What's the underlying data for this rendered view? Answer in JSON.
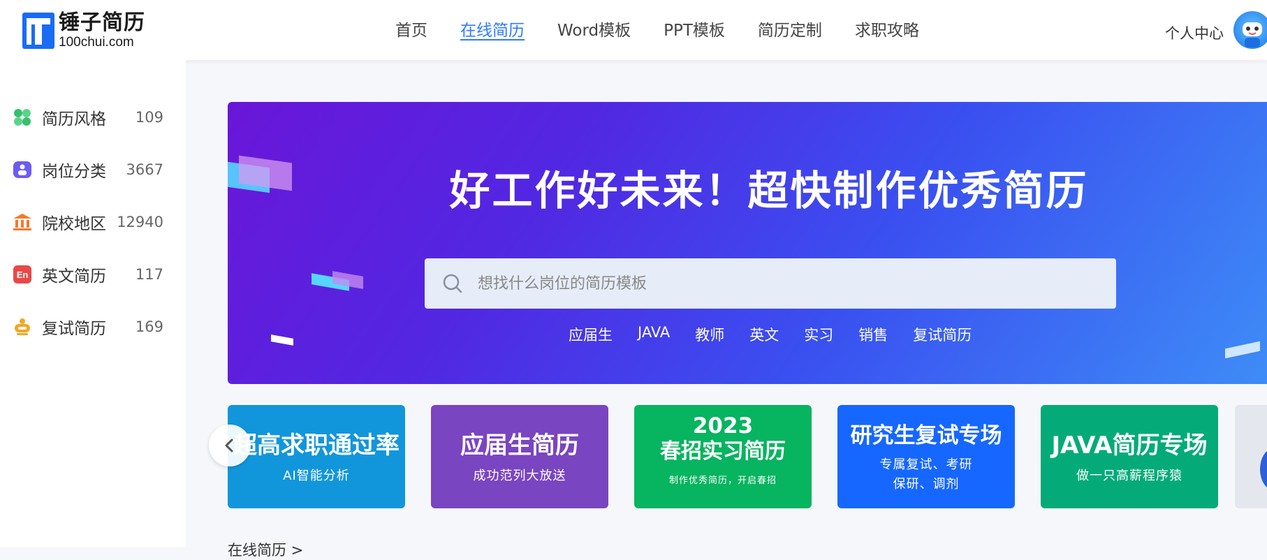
{
  "header": {
    "logo_cn": "锤子简历",
    "logo_en": "100chui.com",
    "nav": [
      {
        "label": "首页",
        "active": false
      },
      {
        "label": "在线简历",
        "active": true
      },
      {
        "label": "Word模板",
        "active": false
      },
      {
        "label": "PPT模板",
        "active": false
      },
      {
        "label": "简历定制",
        "active": false
      },
      {
        "label": "求职攻略",
        "active": false
      }
    ],
    "user_center": "个人中心",
    "accent_color": "#2f7bff"
  },
  "sidebar": {
    "items": [
      {
        "label": "简历风格",
        "count": "109",
        "icon": "clover-icon"
      },
      {
        "label": "岗位分类",
        "count": "3667",
        "icon": "briefcase-icon"
      },
      {
        "label": "院校地区",
        "count": "12940",
        "icon": "school-building-icon"
      },
      {
        "label": "英文简历",
        "count": "117",
        "icon": "en-badge-icon"
      },
      {
        "label": "复试简历",
        "count": "169",
        "icon": "crown-icon"
      }
    ]
  },
  "banner": {
    "title": "好工作好未来！超快制作优秀简历",
    "search_placeholder": "想找什么岗位的简历模板",
    "tags": [
      "应届生",
      "JAVA",
      "教师",
      "英文",
      "实习",
      "销售",
      "复试简历"
    ]
  },
  "promos": [
    {
      "title": "超高求职通过率",
      "subtitle": "AI智能分析",
      "color": "#1296db"
    },
    {
      "title": "应届生简历",
      "subtitle": "成功范列大放送",
      "color": "#7a45c0"
    },
    {
      "title_year": "2023",
      "title": "春招实习简历",
      "subtitle": "制作优秀简历，开启春招",
      "color": "#07b45f"
    },
    {
      "title": "研究生复试专场",
      "subtitle_line1": "专属复试、考研",
      "subtitle_line2": "保研、调剂",
      "color": "#1667ff"
    },
    {
      "title": "JAVA简历专场",
      "subtitle": "做一只高薪程序猿",
      "color": "#04ab78"
    }
  ],
  "section": {
    "title": "在线简历 >"
  }
}
